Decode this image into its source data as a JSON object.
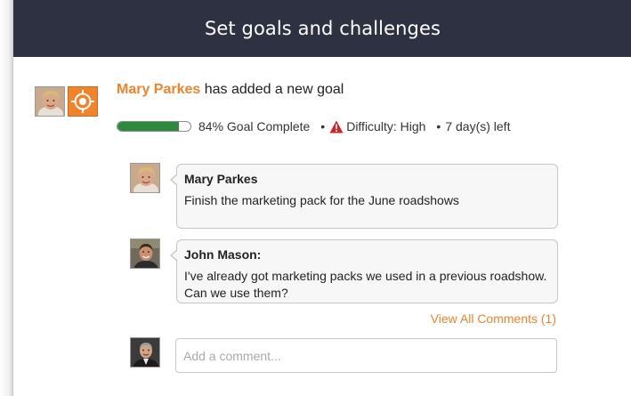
{
  "header": {
    "title": "Set goals and challenges"
  },
  "activity": {
    "user": "Mary Parkes",
    "action": "has added a new goal",
    "progress_percent": 84,
    "progress_label": "84% Goal Complete",
    "bullet": "•",
    "difficulty_label": "Difficulty: High",
    "days_left_label": "7 day(s) left",
    "colors": {
      "accent": "#f2832b",
      "progress": "#2b8a3e",
      "warning": "#d32222"
    }
  },
  "comments": [
    {
      "author": "Mary Parkes",
      "text": "Finish the marketing pack for the June roadshows"
    },
    {
      "author": "John Mason:",
      "text": "I've already got marketing packs we used in a previous roadshow. Can we use them?"
    }
  ],
  "view_all_label": "View All Comments (1)",
  "comment_box": {
    "placeholder": "Add a comment..."
  }
}
